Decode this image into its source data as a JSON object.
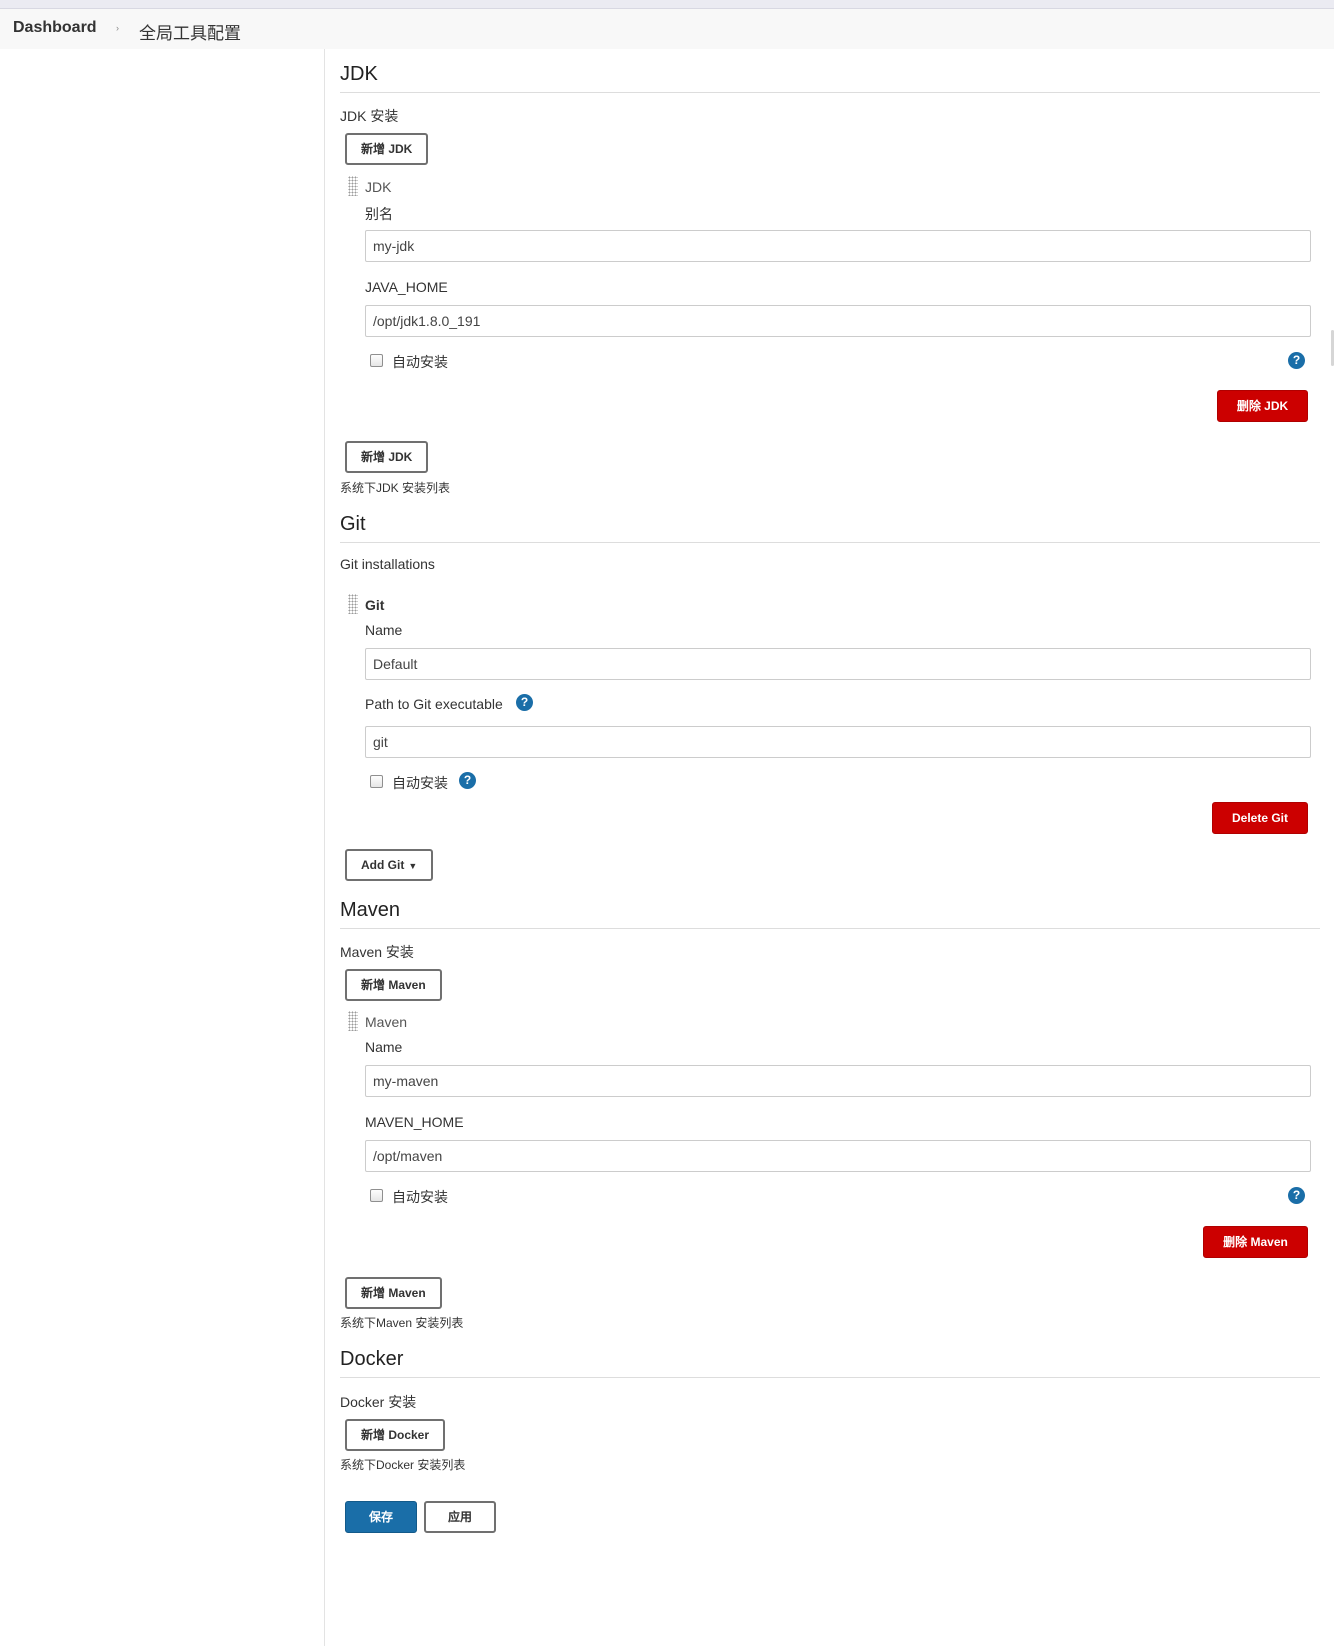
{
  "breadcrumb": {
    "dashboard": "Dashboard",
    "separator": "›",
    "current": "全局工具配置"
  },
  "jdk": {
    "title": "JDK",
    "installs_label": "JDK 安装",
    "add_button": "新增 JDK",
    "item_title": "JDK",
    "alias_label": "别名",
    "alias_value": "my-jdk",
    "home_label": "JAVA_HOME",
    "home_value": "/opt/jdk1.8.0_191",
    "auto_install_label": "自动安装",
    "delete_button": "删除 JDK",
    "description": "系统下JDK 安装列表"
  },
  "git": {
    "title": "Git",
    "installs_label": "Git installations",
    "item_title": "Git",
    "name_label": "Name",
    "name_value": "Default",
    "path_label": "Path to Git executable",
    "path_value": "git",
    "auto_install_label": "自动安装",
    "delete_button": "Delete Git",
    "add_button": "Add Git",
    "add_caret": "▼"
  },
  "maven": {
    "title": "Maven",
    "installs_label": "Maven 安装",
    "add_button": "新增 Maven",
    "item_title": "Maven",
    "name_label": "Name",
    "name_value": "my-maven",
    "home_label": "MAVEN_HOME",
    "home_value": "/opt/maven",
    "auto_install_label": "自动安装",
    "delete_button": "删除 Maven",
    "description": "系统下Maven 安装列表"
  },
  "docker": {
    "title": "Docker",
    "installs_label": "Docker 安装",
    "add_button": "新增 Docker",
    "description": "系统下Docker 安装列表"
  },
  "footer": {
    "save_button": "保存",
    "apply_button": "应用"
  },
  "help_glyph": "?",
  "colors": {
    "danger": "#cc0000",
    "primary": "#1a6ea8",
    "breadcrumb_bg": "#f8f8f8"
  },
  "icons": {
    "drag_handle": "drag-handle-icon",
    "help": "help-icon",
    "chevron": "chevron-right-icon",
    "caret": "caret-down-icon"
  }
}
